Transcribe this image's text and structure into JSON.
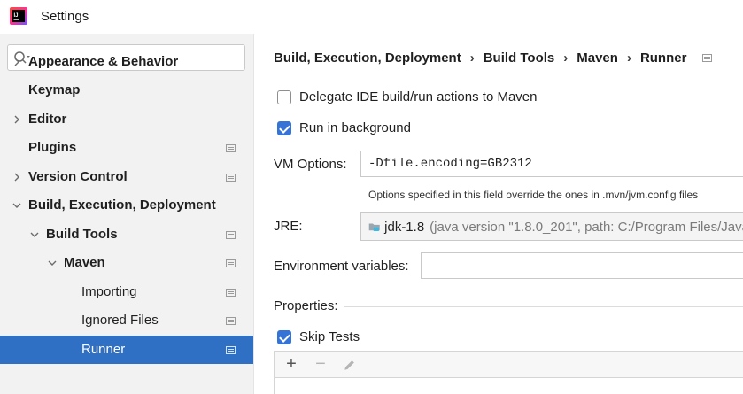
{
  "window": {
    "title": "Settings"
  },
  "search": {
    "placeholder": "",
    "value": ""
  },
  "sidebar": {
    "items": [
      {
        "label": "Appearance & Behavior",
        "expandable": true,
        "expanded": false,
        "project_icon": false
      },
      {
        "label": "Keymap",
        "expandable": false,
        "project_icon": false
      },
      {
        "label": "Editor",
        "expandable": true,
        "expanded": false,
        "project_icon": false
      },
      {
        "label": "Plugins",
        "expandable": false,
        "project_icon": true
      },
      {
        "label": "Version Control",
        "expandable": true,
        "expanded": false,
        "project_icon": true
      },
      {
        "label": "Build, Execution, Deployment",
        "expandable": true,
        "expanded": true,
        "project_icon": false
      },
      {
        "label": "Build Tools",
        "expandable": true,
        "expanded": true,
        "project_icon": true
      },
      {
        "label": "Maven",
        "expandable": true,
        "expanded": true,
        "project_icon": true
      },
      {
        "label": "Importing",
        "expandable": false,
        "project_icon": true
      },
      {
        "label": "Ignored Files",
        "expandable": false,
        "project_icon": true
      },
      {
        "label": "Runner",
        "expandable": false,
        "project_icon": true,
        "selected": true
      }
    ]
  },
  "breadcrumb": {
    "parts": [
      "Build, Execution, Deployment",
      "Build Tools",
      "Maven",
      "Runner"
    ],
    "separator": "›"
  },
  "form": {
    "delegate": {
      "label": "Delegate IDE build/run actions to Maven",
      "checked": false
    },
    "run_background": {
      "label": "Run in background",
      "checked": true
    },
    "vm_options": {
      "label": "VM Options:",
      "value": "-Dfile.encoding=GB2312"
    },
    "vm_hint": "Options specified in this field override the ones in .mvn/jvm.config files",
    "jre": {
      "label": "JRE:",
      "name": "jdk-1.8",
      "detail": "(java version \"1.8.0_201\", path: C:/Program Files/Java"
    },
    "env_vars": {
      "label": "Environment variables:",
      "value": ""
    },
    "properties": {
      "label": "Properties:"
    },
    "skip_tests": {
      "label": "Skip Tests",
      "checked": true
    }
  },
  "toolbar": {
    "add": "+",
    "remove": "−"
  },
  "colors": {
    "selected_bg": "#2f6fc4",
    "checkbox_accent": "#3574d6",
    "sidebar_bg": "#f2f2f2"
  }
}
